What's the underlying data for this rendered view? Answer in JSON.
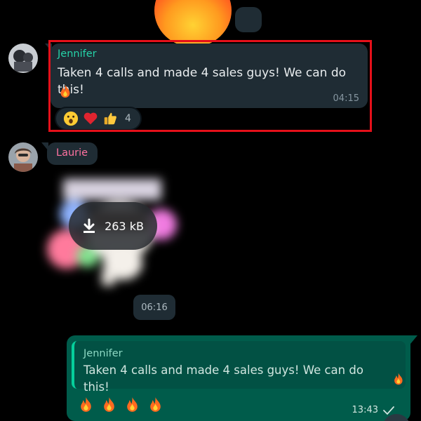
{
  "messages": [
    {
      "sender": "Jennifer",
      "text": "Taken 4 calls and made 4 sales guys! We can do this!",
      "time": "04:15",
      "reactions": [
        "astonished-face",
        "red-heart",
        "thumbs-up"
      ],
      "reaction_count": "4"
    },
    {
      "sender": "Laurie",
      "sticker_size": "263 kB",
      "time": "06:16"
    },
    {
      "quoted_sender": "Jennifer",
      "quoted_text": "Taken 4 calls and made 4 sales guys! We can do this!",
      "emojis": [
        "fire",
        "fire",
        "fire",
        "fire"
      ],
      "time": "13:43",
      "status": "sent-check"
    }
  ],
  "colors": {
    "bubble_in": "#1f2c34",
    "bubble_out": "#005c4b",
    "jennifer_name": "#53bdeb",
    "laurie_name": "#ff72a1",
    "highlight": "#e5101a"
  }
}
